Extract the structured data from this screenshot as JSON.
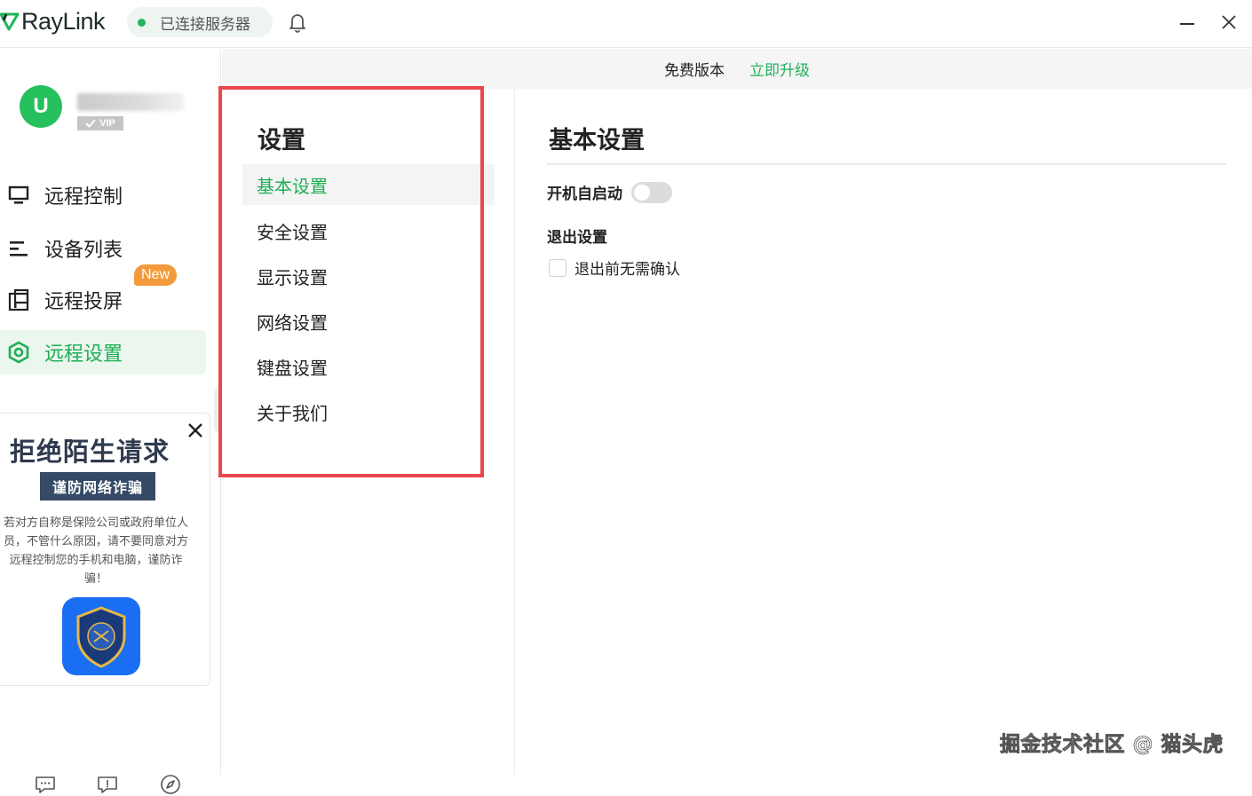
{
  "app": {
    "name": "RayLink",
    "status_text": "已连接服务器",
    "status_color": "#23b55a"
  },
  "user": {
    "avatar_letter": "U",
    "vip_label": "VIP"
  },
  "nav": {
    "items": [
      {
        "label": "远程控制",
        "icon": "monitor-icon"
      },
      {
        "label": "设备列表",
        "icon": "list-icon"
      },
      {
        "label": "远程投屏",
        "icon": "screen-cast-icon"
      },
      {
        "label": "远程设置",
        "icon": "settings-hexagon-icon",
        "active": true
      }
    ],
    "new_badge": "New"
  },
  "ad": {
    "title": "拒绝陌生请求",
    "subtitle": "谨防网络诈骗",
    "body": "若对方自称是保险公司或政府单位人员，不管什么原因，请不要同意对方远程控制您的手机和电脑，谨防诈骗！"
  },
  "upgrade_bar": {
    "free_label": "免费版本",
    "upgrade_label": "立即升级"
  },
  "settings_menu": {
    "title": "设置",
    "items": [
      "基本设置",
      "安全设置",
      "显示设置",
      "网络设置",
      "键盘设置",
      "关于我们"
    ],
    "active_index": 0
  },
  "content": {
    "title": "基本设置",
    "autostart_label": "开机自启动",
    "autostart_on": false,
    "exit_section_label": "退出设置",
    "exit_confirm_label": "退出前无需确认",
    "exit_confirm_checked": false
  },
  "watermark": "掘金技术社区 @ 猫头虎",
  "colors": {
    "accent": "#23b05a",
    "highlight_box": "#e8484b",
    "new_badge": "#f39a3a"
  }
}
